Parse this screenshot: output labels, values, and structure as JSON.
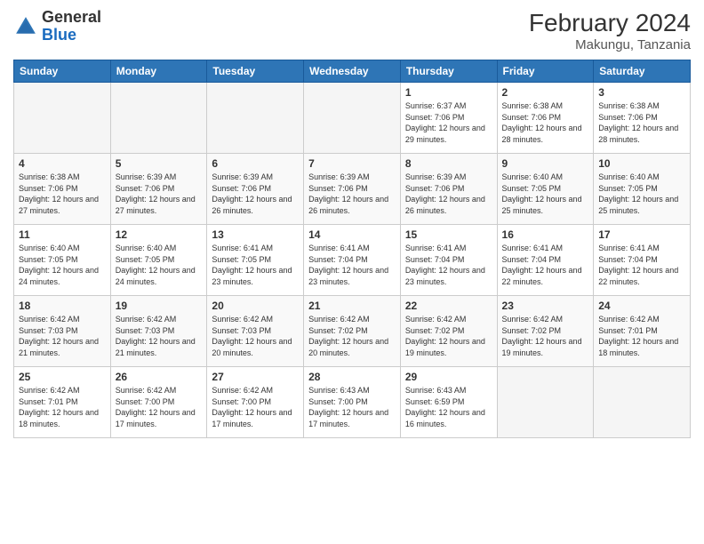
{
  "header": {
    "logo_general": "General",
    "logo_blue": "Blue",
    "month_year": "February 2024",
    "location": "Makungu, Tanzania"
  },
  "days_of_week": [
    "Sunday",
    "Monday",
    "Tuesday",
    "Wednesday",
    "Thursday",
    "Friday",
    "Saturday"
  ],
  "weeks": [
    [
      {
        "day": null
      },
      {
        "day": null
      },
      {
        "day": null
      },
      {
        "day": null
      },
      {
        "day": 1,
        "sunrise": "6:37 AM",
        "sunset": "7:06 PM",
        "daylight": "12 hours and 29 minutes."
      },
      {
        "day": 2,
        "sunrise": "6:38 AM",
        "sunset": "7:06 PM",
        "daylight": "12 hours and 28 minutes."
      },
      {
        "day": 3,
        "sunrise": "6:38 AM",
        "sunset": "7:06 PM",
        "daylight": "12 hours and 28 minutes."
      }
    ],
    [
      {
        "day": 4,
        "sunrise": "6:38 AM",
        "sunset": "7:06 PM",
        "daylight": "12 hours and 27 minutes."
      },
      {
        "day": 5,
        "sunrise": "6:39 AM",
        "sunset": "7:06 PM",
        "daylight": "12 hours and 27 minutes."
      },
      {
        "day": 6,
        "sunrise": "6:39 AM",
        "sunset": "7:06 PM",
        "daylight": "12 hours and 26 minutes."
      },
      {
        "day": 7,
        "sunrise": "6:39 AM",
        "sunset": "7:06 PM",
        "daylight": "12 hours and 26 minutes."
      },
      {
        "day": 8,
        "sunrise": "6:39 AM",
        "sunset": "7:06 PM",
        "daylight": "12 hours and 26 minutes."
      },
      {
        "day": 9,
        "sunrise": "6:40 AM",
        "sunset": "7:05 PM",
        "daylight": "12 hours and 25 minutes."
      },
      {
        "day": 10,
        "sunrise": "6:40 AM",
        "sunset": "7:05 PM",
        "daylight": "12 hours and 25 minutes."
      }
    ],
    [
      {
        "day": 11,
        "sunrise": "6:40 AM",
        "sunset": "7:05 PM",
        "daylight": "12 hours and 24 minutes."
      },
      {
        "day": 12,
        "sunrise": "6:40 AM",
        "sunset": "7:05 PM",
        "daylight": "12 hours and 24 minutes."
      },
      {
        "day": 13,
        "sunrise": "6:41 AM",
        "sunset": "7:05 PM",
        "daylight": "12 hours and 23 minutes."
      },
      {
        "day": 14,
        "sunrise": "6:41 AM",
        "sunset": "7:04 PM",
        "daylight": "12 hours and 23 minutes."
      },
      {
        "day": 15,
        "sunrise": "6:41 AM",
        "sunset": "7:04 PM",
        "daylight": "12 hours and 23 minutes."
      },
      {
        "day": 16,
        "sunrise": "6:41 AM",
        "sunset": "7:04 PM",
        "daylight": "12 hours and 22 minutes."
      },
      {
        "day": 17,
        "sunrise": "6:41 AM",
        "sunset": "7:04 PM",
        "daylight": "12 hours and 22 minutes."
      }
    ],
    [
      {
        "day": 18,
        "sunrise": "6:42 AM",
        "sunset": "7:03 PM",
        "daylight": "12 hours and 21 minutes."
      },
      {
        "day": 19,
        "sunrise": "6:42 AM",
        "sunset": "7:03 PM",
        "daylight": "12 hours and 21 minutes."
      },
      {
        "day": 20,
        "sunrise": "6:42 AM",
        "sunset": "7:03 PM",
        "daylight": "12 hours and 20 minutes."
      },
      {
        "day": 21,
        "sunrise": "6:42 AM",
        "sunset": "7:02 PM",
        "daylight": "12 hours and 20 minutes."
      },
      {
        "day": 22,
        "sunrise": "6:42 AM",
        "sunset": "7:02 PM",
        "daylight": "12 hours and 19 minutes."
      },
      {
        "day": 23,
        "sunrise": "6:42 AM",
        "sunset": "7:02 PM",
        "daylight": "12 hours and 19 minutes."
      },
      {
        "day": 24,
        "sunrise": "6:42 AM",
        "sunset": "7:01 PM",
        "daylight": "12 hours and 18 minutes."
      }
    ],
    [
      {
        "day": 25,
        "sunrise": "6:42 AM",
        "sunset": "7:01 PM",
        "daylight": "12 hours and 18 minutes."
      },
      {
        "day": 26,
        "sunrise": "6:42 AM",
        "sunset": "7:00 PM",
        "daylight": "12 hours and 17 minutes."
      },
      {
        "day": 27,
        "sunrise": "6:42 AM",
        "sunset": "7:00 PM",
        "daylight": "12 hours and 17 minutes."
      },
      {
        "day": 28,
        "sunrise": "6:43 AM",
        "sunset": "7:00 PM",
        "daylight": "12 hours and 17 minutes."
      },
      {
        "day": 29,
        "sunrise": "6:43 AM",
        "sunset": "6:59 PM",
        "daylight": "12 hours and 16 minutes."
      },
      {
        "day": null
      },
      {
        "day": null
      }
    ]
  ]
}
